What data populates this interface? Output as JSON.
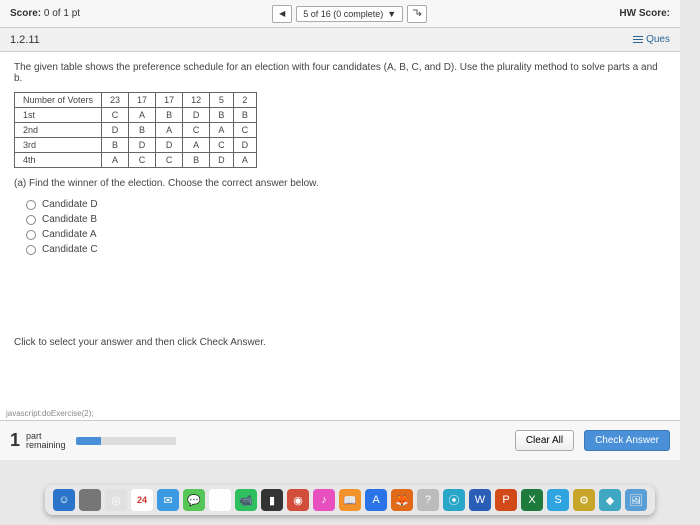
{
  "topbar": {
    "score_label": "Score:",
    "score_value": "0 of 1 pt",
    "progress": "5 of 16 (0 complete)",
    "hw_score_label": "HW Score:"
  },
  "question_bar": {
    "qnum": "1.2.11",
    "ques_label": "Ques"
  },
  "problem": {
    "desc": "The given table shows the preference schedule for an election with four candidates (A, B, C, and D). Use the plurality method to solve parts a and b.",
    "part_a": "(a) Find the winner of the election. Choose the correct answer below.",
    "instruction": "Click to select your answer and then click Check Answer."
  },
  "table": {
    "header": [
      "Number of Voters",
      "23",
      "17",
      "17",
      "12",
      "5",
      "2"
    ],
    "rows": [
      [
        "1st",
        "C",
        "A",
        "B",
        "D",
        "B",
        "B"
      ],
      [
        "2nd",
        "D",
        "B",
        "A",
        "C",
        "A",
        "C"
      ],
      [
        "3rd",
        "B",
        "D",
        "D",
        "A",
        "C",
        "D"
      ],
      [
        "4th",
        "A",
        "C",
        "C",
        "B",
        "D",
        "A"
      ]
    ]
  },
  "options": [
    "Candidate D",
    "Candidate B",
    "Candidate A",
    "Candidate C"
  ],
  "footer": {
    "parts_num": "1",
    "parts_label_1": "part",
    "parts_label_2": "remaining",
    "clear_all": "Clear All",
    "check": "Check Answer",
    "jsstatus": "javascript:doExercise(2);"
  },
  "dock": {
    "items": [
      {
        "name": "finder",
        "bg": "#2a74c9",
        "glyph": "☺"
      },
      {
        "name": "launchpad",
        "bg": "#777",
        "glyph": ""
      },
      {
        "name": "safari",
        "bg": "#e0e0e0",
        "glyph": "◎"
      },
      {
        "name": "calendar",
        "bg": "#fff",
        "glyph": "24"
      },
      {
        "name": "mail",
        "bg": "#3b9ae1",
        "glyph": "✉"
      },
      {
        "name": "messages",
        "bg": "#56c756",
        "glyph": "💬"
      },
      {
        "name": "photos",
        "bg": "#fff",
        "glyph": "✿"
      },
      {
        "name": "facetime",
        "bg": "#2fbf5e",
        "glyph": "📹"
      },
      {
        "name": "terminal",
        "bg": "#333",
        "glyph": "▮"
      },
      {
        "name": "app1",
        "bg": "#d24e3a",
        "glyph": "◉"
      },
      {
        "name": "itunes",
        "bg": "#e84fbf",
        "glyph": "♪"
      },
      {
        "name": "ibooks",
        "bg": "#f0932a",
        "glyph": "📖"
      },
      {
        "name": "appstore",
        "bg": "#2a74e8",
        "glyph": "A"
      },
      {
        "name": "firefox",
        "bg": "#e06a1a",
        "glyph": "🦊"
      },
      {
        "name": "help",
        "bg": "#bbb",
        "glyph": "?"
      },
      {
        "name": "openoffice",
        "bg": "#2aa6c9",
        "glyph": "⦿"
      },
      {
        "name": "word",
        "bg": "#2a5db5",
        "glyph": "W"
      },
      {
        "name": "powerpoint",
        "bg": "#d24a1a",
        "glyph": "P"
      },
      {
        "name": "excel",
        "bg": "#1f7a3d",
        "glyph": "X"
      },
      {
        "name": "skype",
        "bg": "#30a4e0",
        "glyph": "S"
      },
      {
        "name": "app2",
        "bg": "#c7a62a",
        "glyph": "⚙"
      },
      {
        "name": "app3",
        "bg": "#3fa7c2",
        "glyph": "◆"
      },
      {
        "name": "preview",
        "bg": "#5a9ed6",
        "glyph": "🖼"
      }
    ]
  }
}
